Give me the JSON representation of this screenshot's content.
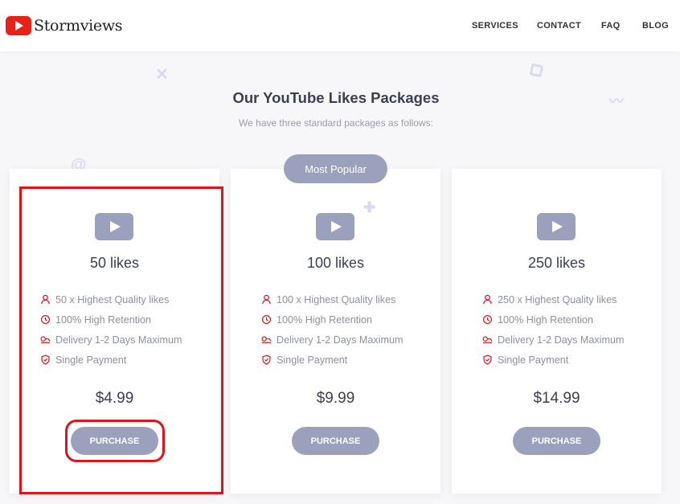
{
  "brand": {
    "name": "Stormviews",
    "logo_icon": "youtube-play-icon",
    "logo_color": "#e62117"
  },
  "nav": {
    "items": [
      "SERVICES",
      "CONTACT",
      "FAQ",
      "BLOG"
    ]
  },
  "section": {
    "title": "Our YouTube Likes Packages",
    "subtitle": "We have three standard packages as follows:"
  },
  "badge": {
    "label": "Most Popular"
  },
  "colors": {
    "accent": "#9ba1bc",
    "feature_icon": "#e0141b",
    "highlight": "#e0141b"
  },
  "packages": [
    {
      "name": "50 likes",
      "features": [
        "50 x Highest Quality likes",
        "100% High Retention",
        "Delivery 1-2 Days Maximum",
        "Single Payment"
      ],
      "price": "$4.99",
      "button": "PURCHASE"
    },
    {
      "name": "100 likes",
      "features": [
        "100 x Highest Quality likes",
        "100% High Retention",
        "Delivery 1-2 Days Maximum",
        "Single Payment"
      ],
      "price": "$9.99",
      "button": "PURCHASE"
    },
    {
      "name": "250 likes",
      "features": [
        "250 x Highest Quality likes",
        "100% High Retention",
        "Delivery 1-2 Days Maximum",
        "Single Payment"
      ],
      "price": "$14.99",
      "button": "PURCHASE"
    }
  ],
  "feature_icons": [
    "user-icon",
    "clock-icon",
    "delivery-icon",
    "shield-icon"
  ]
}
